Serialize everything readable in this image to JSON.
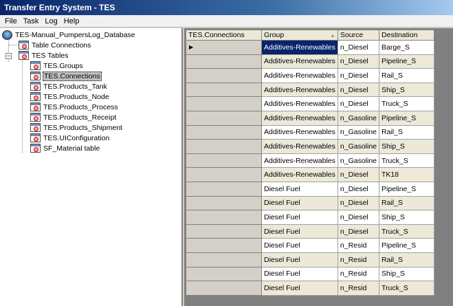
{
  "window": {
    "title": "Transfer Entry System - TES"
  },
  "menu": [
    "File",
    "Task",
    "Log",
    "Help"
  ],
  "tree": {
    "root": "TES-Manual_PumpersLog_Database",
    "connections": "Table Connections",
    "tables_group": "TES Tables",
    "tables": [
      "TES.Groups",
      "TES.Connections",
      "TES.Products_Tank",
      "TES.Products_Node",
      "TES.Products_Process",
      "TES.Products_Receipt",
      "TES.Products_Shipment",
      "TES.UIConfiguration",
      "SF_Material table"
    ],
    "selected_table": "TES.Connections"
  },
  "grid": {
    "row_header_title": "TES.Connections",
    "columns": [
      "Group",
      "Source",
      "Destination"
    ],
    "rows": [
      [
        "Additives-Renewables",
        "n_Diesel",
        "Barge_S"
      ],
      [
        "Additives-Renewables",
        "n_Diesel",
        "Pipeline_S"
      ],
      [
        "Additives-Renewables",
        "n_Diesel",
        "Rail_S"
      ],
      [
        "Additives-Renewables",
        "n_Diesel",
        "Ship_S"
      ],
      [
        "Additives-Renewables",
        "n_Diesel",
        "Truck_S"
      ],
      [
        "Additives-Renewables",
        "n_Gasoline",
        "Pipeline_S"
      ],
      [
        "Additives-Renewables",
        "n_Gasoline",
        "Rail_S"
      ],
      [
        "Additives-Renewables",
        "n_Gasoline",
        "Ship_S"
      ],
      [
        "Additives-Renewables",
        "n_Gasoline",
        "Truck_S"
      ],
      [
        "Additives-Renewables",
        "n_Diesel",
        "TK18"
      ],
      [
        "Diesel Fuel",
        "n_Diesel",
        "Pipeline_S"
      ],
      [
        "Diesel Fuel",
        "n_Diesel",
        "Rail_S"
      ],
      [
        "Diesel Fuel",
        "n_Diesel",
        "Ship_S"
      ],
      [
        "Diesel Fuel",
        "n_Diesel",
        "Truck_S"
      ],
      [
        "Diesel Fuel",
        "n_Resid",
        "Pipeline_S"
      ],
      [
        "Diesel Fuel",
        "n_Resid",
        "Rail_S"
      ],
      [
        "Diesel Fuel",
        "n_Resid",
        "Ship_S"
      ],
      [
        "Diesel Fuel",
        "n_Resid",
        "Truck_S"
      ]
    ],
    "current_row": 0
  },
  "colors": {
    "title_start": "#0a246a",
    "title_end": "#a6caf0",
    "selection": "#0a246a"
  }
}
